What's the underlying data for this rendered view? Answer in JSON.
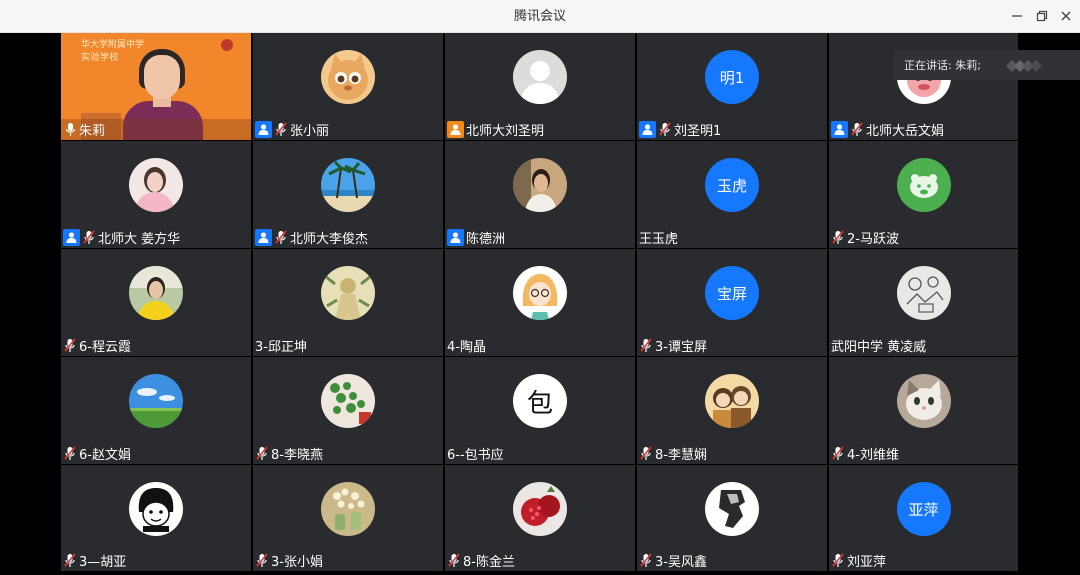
{
  "window": {
    "title": "腾讯会议"
  },
  "speaking": {
    "label": "正在讲话: 朱莉;"
  },
  "colors": {
    "host_badge": "#1677ff",
    "host_badge_orange": "#f08a1c",
    "tile_bg": "#2a2b2f",
    "video_bg": "#f2862a"
  },
  "video_tile": {
    "board_line1": "华大学附属中学",
    "board_line2": "实验学校"
  },
  "tiles": [
    {
      "name": "朱莉",
      "avatar": "video",
      "mic": "on",
      "badge": "none"
    },
    {
      "name": "张小丽",
      "avatar": "cat-orange",
      "mic": "muted",
      "badge": "host"
    },
    {
      "name": "北师大刘圣明",
      "avatar": "silhouette",
      "mic": "none",
      "badge": "host-orange"
    },
    {
      "name": "刘圣明1",
      "avatar": "text",
      "avatar_text": "明1",
      "mic": "muted",
      "badge": "host"
    },
    {
      "name": "北师大岳文娟",
      "avatar": "cartoon-pink",
      "mic": "muted",
      "badge": "host"
    },
    {
      "name": "北师大 姜方华",
      "avatar": "photo-woman",
      "mic": "muted",
      "badge": "host"
    },
    {
      "name": "北师大李俊杰",
      "avatar": "photo-beach",
      "mic": "muted",
      "badge": "host"
    },
    {
      "name": "陈德洲",
      "avatar": "photo-man",
      "mic": "none",
      "badge": "host"
    },
    {
      "name": "王玉虎",
      "avatar": "text",
      "avatar_text": "玉虎",
      "mic": "none",
      "badge": "none"
    },
    {
      "name": "2-马跃波",
      "avatar": "green-pig",
      "mic": "muted",
      "badge": "none"
    },
    {
      "name": "6-程云霞",
      "avatar": "photo-yellow",
      "mic": "muted",
      "badge": "none"
    },
    {
      "name": "3-邱正坤",
      "avatar": "photo-statue",
      "mic": "none",
      "badge": "none"
    },
    {
      "name": "4-陶晶",
      "avatar": "cartoon-girl",
      "mic": "none",
      "badge": "none"
    },
    {
      "name": "3-谭宝屏",
      "avatar": "text",
      "avatar_text": "宝屏",
      "mic": "muted",
      "badge": "none"
    },
    {
      "name": "武阳中学 黄凌威",
      "avatar": "sketch",
      "mic": "none",
      "badge": "none"
    },
    {
      "name": "6-赵文娟",
      "avatar": "sky-field",
      "mic": "muted",
      "badge": "none"
    },
    {
      "name": "8-李晓燕",
      "avatar": "plant",
      "mic": "muted",
      "badge": "none"
    },
    {
      "name": "6--包书应",
      "avatar": "ink",
      "avatar_text": "包",
      "mic": "none",
      "badge": "none"
    },
    {
      "name": "8-李慧娴",
      "avatar": "cartoon-duo",
      "mic": "muted",
      "badge": "none"
    },
    {
      "name": "4-刘维维",
      "avatar": "cat-white",
      "mic": "muted",
      "badge": "none"
    },
    {
      "name": "3—胡亚",
      "avatar": "meme",
      "mic": "muted",
      "badge": "none"
    },
    {
      "name": "3-张小娟",
      "avatar": "flowers",
      "mic": "muted",
      "badge": "none"
    },
    {
      "name": "8-陈金兰",
      "avatar": "pomegranate",
      "mic": "muted",
      "badge": "none"
    },
    {
      "name": "3-吴风鑫",
      "avatar": "bw-photo",
      "mic": "muted",
      "badge": "none"
    },
    {
      "name": "刘亚萍",
      "avatar": "text",
      "avatar_text": "亚萍",
      "mic": "muted",
      "badge": "none"
    }
  ]
}
